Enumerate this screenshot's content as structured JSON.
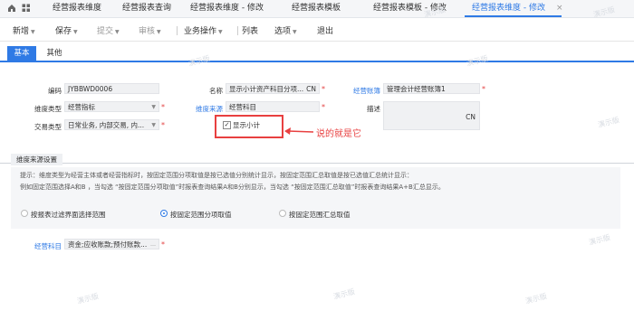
{
  "tabbar": {
    "tabs": [
      {
        "label": "经营报表维度"
      },
      {
        "label": "经营报表查询"
      },
      {
        "label": "经营报表维度 - 修改"
      },
      {
        "label": "经营报表模板"
      },
      {
        "label": "经营报表模板 - 修改"
      },
      {
        "label": "经营报表维度 - 修改",
        "active": true
      }
    ],
    "close_glyph": "×"
  },
  "toolbar": {
    "items": [
      {
        "label": "新增"
      },
      {
        "label": "保存"
      },
      {
        "label": "提交"
      },
      {
        "label": "审核"
      },
      {
        "label": "业务操作"
      },
      {
        "label": "列表"
      },
      {
        "label": "选项"
      },
      {
        "label": "退出"
      }
    ]
  },
  "subtabs": [
    {
      "label": "基本",
      "active": true
    },
    {
      "label": "其他"
    }
  ],
  "form": {
    "code_label": "编码",
    "code_value": "JYBBWD0006",
    "name_label": "名称",
    "name_value": "显示小计资产科目分项...",
    "name_lang": "CN",
    "account_book_label": "经营账簿",
    "account_book_value": "管理会计经营账簿1",
    "dim_type_label": "维度类型",
    "dim_type_value": "经营指标",
    "dim_source_label": "维度来源",
    "dim_source_value": "经营科目",
    "desc_label": "描述",
    "desc_lang": "CN",
    "trade_type_label": "交易类型",
    "trade_type_value": "日常业务, 内部交易, 内...",
    "show_subtotal_label": "显示小计",
    "required_mark": "*"
  },
  "annotation": {
    "text": "说的就是它",
    "arrow_glyph": "←"
  },
  "section": {
    "title": "维度来源设置",
    "hint_lines": [
      "提示：维度类型为经营主体或者经营指标时，按固定范围分项取值是按已选值分别统计显示，按固定范围汇总取值是按已选值汇总统计显示：",
      "例如固定范围选择A和B ，当勾选 “按固定范围分项取值”时报表查询结果A和B分别显示，当勾选 “按固定范围汇总取值”时报表查询结果A+B汇总显示。"
    ],
    "options": [
      {
        "label": "按报表过滤界面选择范围",
        "checked": false
      },
      {
        "label": "按固定范围分项取值",
        "checked": true
      },
      {
        "label": "按固定范围汇总取值",
        "checked": false
      }
    ],
    "subject_label": "经营科目",
    "subject_value": "资金;应收账款;预付账款..."
  },
  "watermark": "演示版"
}
